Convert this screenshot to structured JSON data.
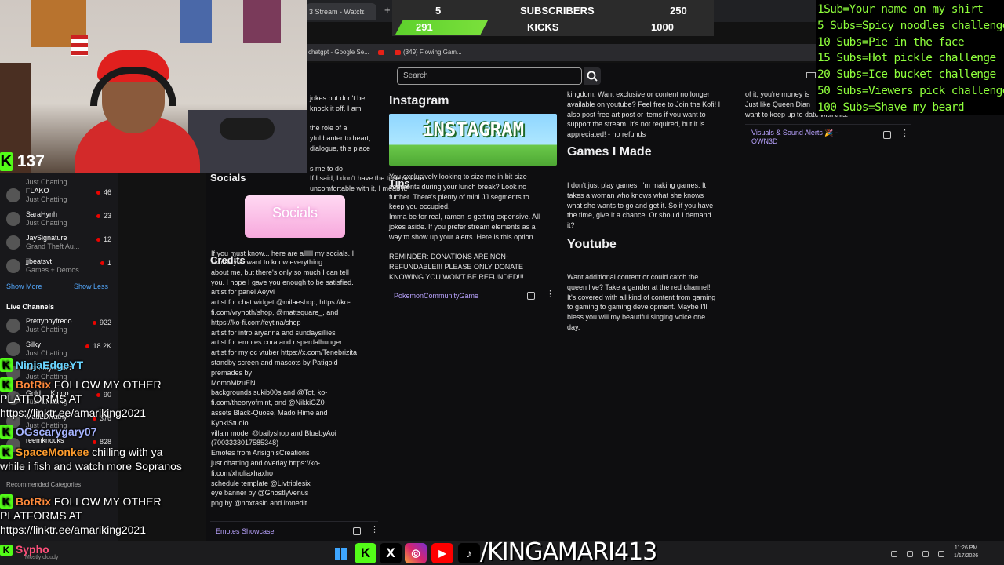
{
  "browser": {
    "tab_title": "3 Stream - Watch",
    "tab_close": "x",
    "new_tab": "+",
    "bookmarks": [
      "chatgpt - Google Se...",
      "(349) Flowing Gam..."
    ],
    "search_placeholder": "Search"
  },
  "sub_bar": {
    "subs_current": "5",
    "subs_label": "SUBSCRIBERS",
    "subs_goal": "250",
    "kicks_current": "291",
    "kicks_label": "KICKS",
    "kicks_goal": "1000",
    "kicks_progress": 0.291,
    "colors": {
      "progress": "#5dd12c"
    }
  },
  "viewer_count": "137",
  "sidebar": {
    "channels": [
      {
        "name": "",
        "game": "Just Chatting",
        "count": ""
      },
      {
        "name": "FLAKO",
        "game": "Just Chatting",
        "count": "46"
      },
      {
        "name": "SaraHynh",
        "game": "Just Chatting",
        "count": "23"
      },
      {
        "name": "JaySignature",
        "game": "Grand Theft Au...",
        "count": "12"
      },
      {
        "name": "jjbeatsvt",
        "game": "Games + Demos",
        "count": "1"
      }
    ],
    "show_more": "Show More",
    "show_less": "Show Less",
    "live_heading": "Live Channels",
    "live_channels": [
      {
        "name": "Prettyboyfredo",
        "game": "Just Chatting",
        "count": "922"
      },
      {
        "name": "Silky",
        "game": "Just Chatting",
        "count": "18.2K"
      },
      {
        "name": "wendolyhortizz",
        "game": "Just Chatting",
        "count": ""
      },
      {
        "name": "Gold.....Kingo",
        "game": "Just Chatting",
        "count": "90"
      },
      {
        "name": "MadLDNathy",
        "game": "Just Chatting",
        "count": "376"
      },
      {
        "name": "reemknocks",
        "game": "",
        "count": "828"
      }
    ],
    "recommended_categories": "Recommended Categories"
  },
  "chat": [
    {
      "user": "NinjaEdgeYT",
      "color": "#69d4ff",
      "text": ""
    },
    {
      "user": "BotRix",
      "color": "#ff8a3c",
      "text": "FOLLOW MY OTHER PLATFORMS AT https://linktr.ee/amariking2021"
    },
    {
      "user": "OGscarygary07",
      "color": "#a6b4ff",
      "text": ""
    },
    {
      "user": "SpaceMonkee",
      "color": "#ff9d2e",
      "text": "chilling with ya while i fish and watch more Sopranos"
    },
    {
      "user": "BotRix",
      "color": "#ff8a3c",
      "text": "FOLLOW MY OTHER PLATFORMS AT https://linktr.ee/amariking2021"
    }
  ],
  "panels": {
    "about_partial": "jokes but don't be\nknock it off, I am\n\nthe role of a\nyful banter to heart,\ndialogue, this place\n\ns me to do\nIf I said, I don't have the time or I am\nuncomfortable with it, I mean it!\n8. Have F",
    "socials_title": "Socials",
    "socials_banner": "Socials",
    "socials_text": "If you must know... here are allllll my socials. I",
    "credits_title": "Credits",
    "credits_text": "I know you want to know everything\nabout me, but there's only so much I can tell\nyou. I hope I gave you enough to be satisfied.\nartist for panel Aeyvi\nartist for chat widget @milaeshop, https://ko-\nfi.com/vryhoth/shop, @mattsquare_, and\nhttps://ko-fi.com/feytina/shop\nartist for intro aryanna and sundaysillies\nartist for emotes cora and risperdalhunger\nartist for my oc vtuber https://x.com/Tenebrizita\nstandby screen and mascots by Patigold\npremades by\nMomoMizuEN\nbackgrounds sukib00s and @Tot, ko-\nfi.com/theoryofmint, and @NikkiGZ0\nassets Black-Quose, Mado Hime and\nKyokiStudio\nvillain model @bailyshop and BluebyAoi\n(7003333017585348)\nEmotes from ArisignisCreations\njust chatting and overlay https://ko-\nfi.com/xhuliaxhaxho\nschedule template @Livtriplesix\neye banner by @GhostlyVenus\npng by @noxrasin and ironedit",
    "emotes_link": "Emotes Showcase",
    "instagram_title": "Instagram",
    "instagram_banner": "iNSTAGRAM",
    "tips_title": "Tips",
    "tips_text": "You exclusively looking to size me in bit size\nsegments during your lunch break? Look no\nfurther. There's plenty of mini JJ segments to\nkeep you occupied.\nImma be for real, ramen is getting expensive. All\njokes aside. If you prefer stream elements as a\nway to show up your alerts. Here is this option.\n\nREMINDER: DONATIONS ARE NON-\nREFUNDABLE!!! PLEASE ONLY DONATE\nKNOWING YOU WON'T BE REFUNDED!!!",
    "pokemon_link": "PokemonCommunityGame",
    "kofi_text": "kingdom. Want exclusive or content no longer\navailable on youtube? Feel free to Join the Kofi! I\nalso post free art post or items if you want to\nsupport the stream. It's not required, but it is\nappreciated! - no refunds",
    "games_title": "Games I Made",
    "games_text": "I don't just play games. I'm making games. It\ntakes a woman who knows what she knows\nwhat she wants to go and get it. So if you have\nthe time, give it a chance. Or should I demand\nit?",
    "youtube_title": "Youtube",
    "youtube_text": "Want additional content or could catch the\nqueen live? Take a gander at the red channel!\nIt's covered with all kind of content from gaming\nto gaming to gaming development. Maybe I'll\nbless you will my beautiful singing voice one\nday.",
    "right_partial": "of it, you're money is\nJust like Queen Dian\nwant to keep up to date with this.",
    "visuals_link": "Visuals & Sound Alerts 🎉 - OWN3D"
  },
  "goals": [
    "1Sub=Your name on my shirt",
    "5 Subs=Spicy noodles challenge",
    "10 Subs=Pie in the face",
    "15 Subs=Hot pickle challenge",
    "20 Subs=Ice bucket challenge",
    "50 Subs=Viewers pick challenge",
    "100 Subs=Shave my beard"
  ],
  "taskbar": {
    "weather_name": "Sypho",
    "weather_sub": "Mostly cloudy",
    "handle": "/KINGAMARI413",
    "time": "11:26 PM",
    "date": "1/17/2026",
    "social_icons": [
      "kick-icon",
      "x-icon",
      "instagram-icon",
      "youtube-icon",
      "tiktok-icon"
    ]
  },
  "colors": {
    "kick_green": "#53fc18",
    "goal_green": "#8fff3c",
    "link_purple": "#b9a3ff"
  }
}
